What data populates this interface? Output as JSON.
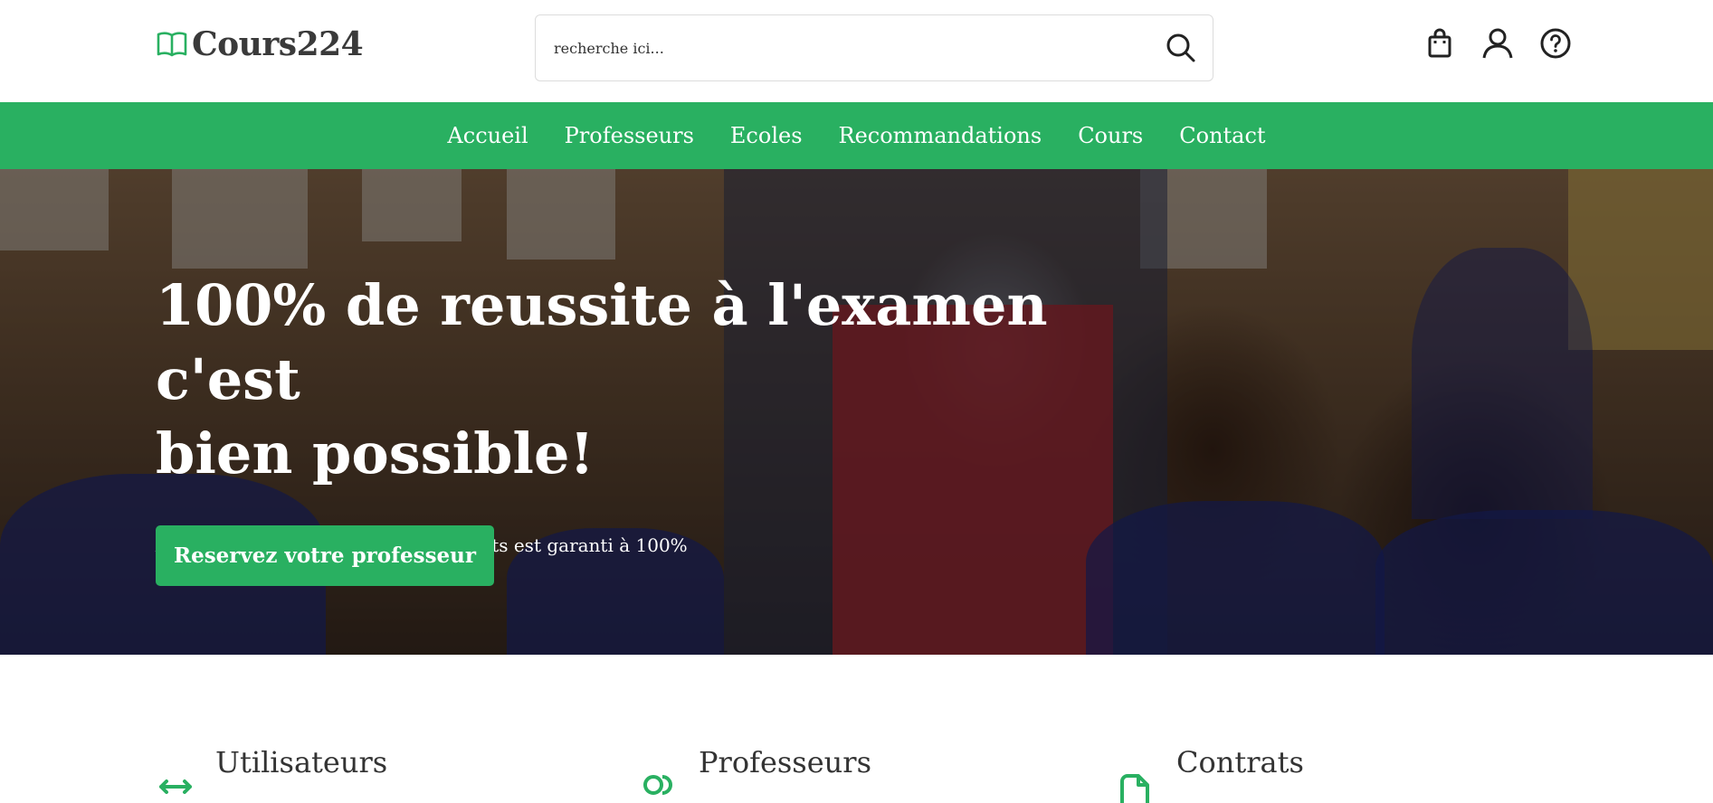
{
  "brand": {
    "name": "Cours224",
    "accent": "#29b061"
  },
  "search": {
    "placeholder": "recherche ici..."
  },
  "header_icons": [
    "shopping-bag-icon",
    "user-icon",
    "help-icon"
  ],
  "nav": {
    "items": [
      {
        "label": "Accueil"
      },
      {
        "label": "Professeurs"
      },
      {
        "label": "Ecoles"
      },
      {
        "label": "Recommandations"
      },
      {
        "label": "Cours"
      },
      {
        "label": "Contact"
      }
    ]
  },
  "hero": {
    "title_line1": "100% de reussite à l'examen c'est",
    "title_line2": "bien possible!",
    "subtitle": "Avec cours224, l'avenir de vos enfants est garanti à 100%",
    "cta_label": "Reservez votre professeur"
  },
  "features": [
    {
      "title": "Utilisateurs",
      "icon": "arrows-exchange-icon"
    },
    {
      "title": "Professeurs",
      "icon": "users-icon"
    },
    {
      "title": "Contrats",
      "icon": "document-icon"
    }
  ]
}
